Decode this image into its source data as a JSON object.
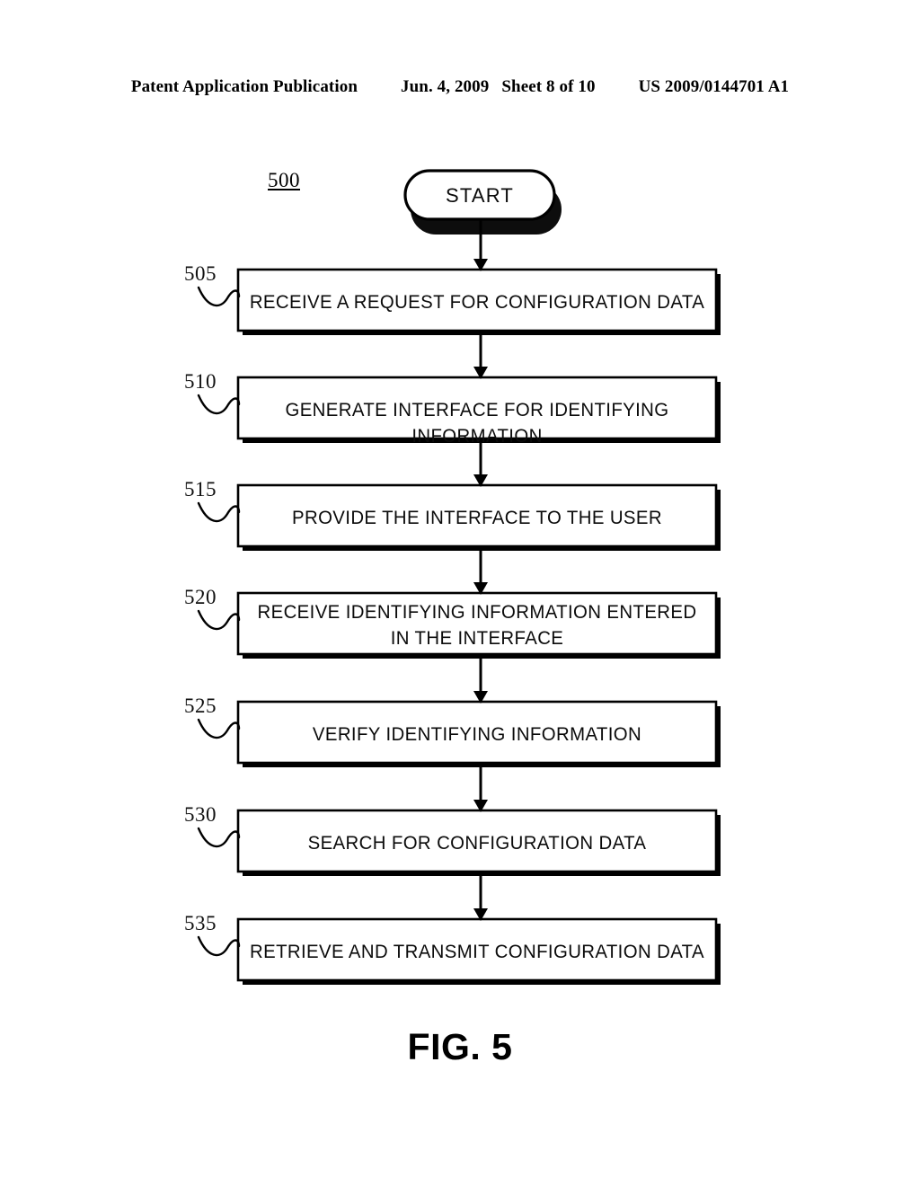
{
  "header": {
    "publication": "Patent Application Publication",
    "date": "Jun. 4, 2009",
    "sheet": "Sheet 8 of 10",
    "patent_number": "US 2009/0144701 A1"
  },
  "figure": {
    "caption": "FIG. 5",
    "diagram_ref": "500",
    "start_label": "START",
    "ink_color": "#000000",
    "background_color": "#ffffff",
    "steps": [
      {
        "ref": "505",
        "text": "RECEIVE A REQUEST FOR CONFIGURATION DATA"
      },
      {
        "ref": "510",
        "text": "GENERATE INTERFACE FOR IDENTIFYING INFORMATION"
      },
      {
        "ref": "515",
        "text": "PROVIDE THE INTERFACE TO THE USER"
      },
      {
        "ref": "520",
        "text": "RECEIVE IDENTIFYING INFORMATION ENTERED\nIN THE INTERFACE"
      },
      {
        "ref": "525",
        "text": "VERIFY IDENTIFYING INFORMATION"
      },
      {
        "ref": "530",
        "text": "SEARCH FOR CONFIGURATION DATA"
      },
      {
        "ref": "535",
        "text": "RETRIEVE AND TRANSMIT CONFIGURATION DATA"
      }
    ]
  }
}
